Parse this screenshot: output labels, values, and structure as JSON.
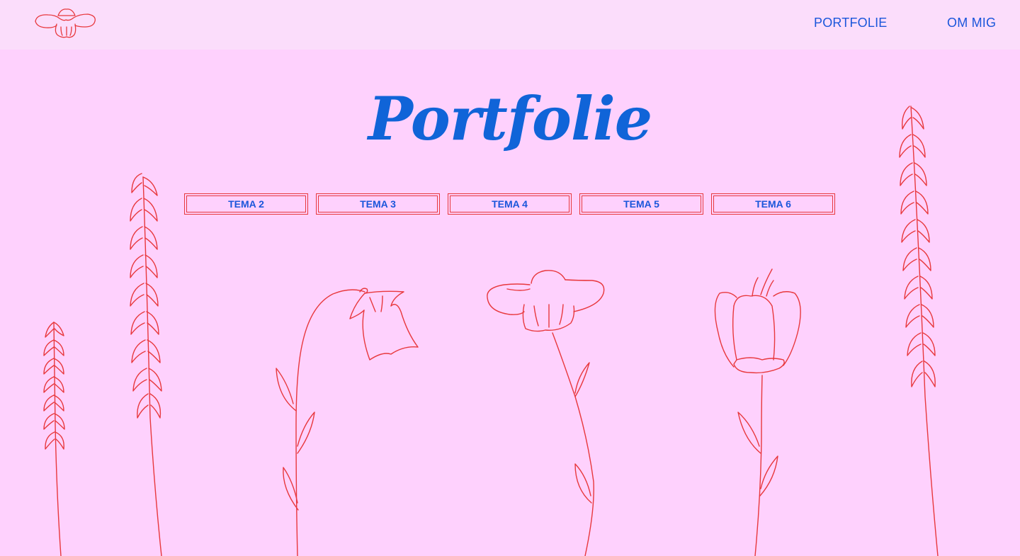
{
  "header": {
    "logo_icon": "flower-logo-icon",
    "nav": [
      {
        "label": "PORTFOLIE"
      },
      {
        "label": "OM MIG"
      }
    ]
  },
  "main": {
    "title": "Portfolie",
    "tabs": [
      {
        "label": "TEMA 2"
      },
      {
        "label": "TEMA 3"
      },
      {
        "label": "TEMA 4"
      },
      {
        "label": "TEMA 5"
      },
      {
        "label": "TEMA 6"
      }
    ]
  },
  "colors": {
    "background": "#fed1fd",
    "header_background": "#fbddfb",
    "accent_blue": "#1a56db",
    "line_red": "#e8383d"
  }
}
